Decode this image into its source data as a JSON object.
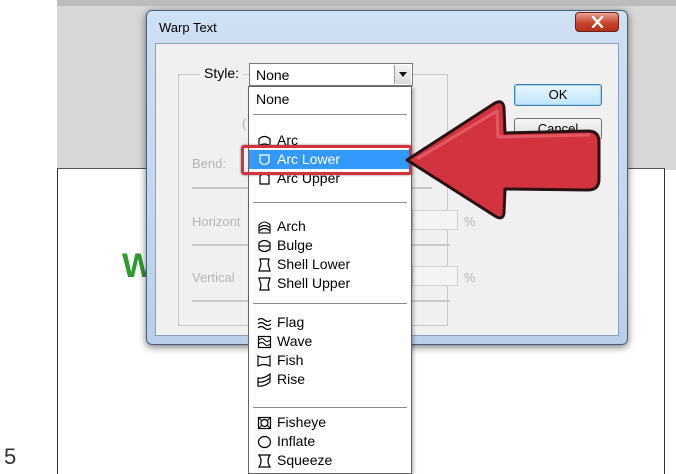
{
  "step_number": "5",
  "canvas_text": "W",
  "dialog": {
    "title": "Warp Text",
    "style_label": "Style:",
    "style_value": "None",
    "bend_label": "Bend:",
    "horizontal_label": "Horizont",
    "vertical_label": "Vertical",
    "percent_symbol": "%",
    "ok_label": "OK",
    "cancel_label": "Cancel",
    "hidden_fragment": "l"
  },
  "dropdown": {
    "items": [
      {
        "label": "None",
        "icon": "none"
      },
      {
        "label": "Arc",
        "icon": "arc-icon"
      },
      {
        "label": "Arc Lower",
        "icon": "arc-lower-icon",
        "selected": true
      },
      {
        "label": "Arc Upper",
        "icon": "arc-upper-icon"
      },
      {
        "label": "Arch",
        "icon": "arch-icon"
      },
      {
        "label": "Bulge",
        "icon": "bulge-icon"
      },
      {
        "label": "Shell Lower",
        "icon": "shell-lower-icon"
      },
      {
        "label": "Shell Upper",
        "icon": "shell-upper-icon"
      },
      {
        "label": "Flag",
        "icon": "flag-icon"
      },
      {
        "label": "Wave",
        "icon": "wave-icon"
      },
      {
        "label": "Fish",
        "icon": "fish-icon"
      },
      {
        "label": "Rise",
        "icon": "rise-icon"
      },
      {
        "label": "Fisheye",
        "icon": "fisheye-icon"
      },
      {
        "label": "Inflate",
        "icon": "inflate-icon"
      },
      {
        "label": "Squeeze",
        "icon": "squeeze-icon"
      }
    ]
  },
  "colors": {
    "highlight": "#d3333f",
    "selection": "#3399ff",
    "canvas_text": "#2f9a2f"
  }
}
